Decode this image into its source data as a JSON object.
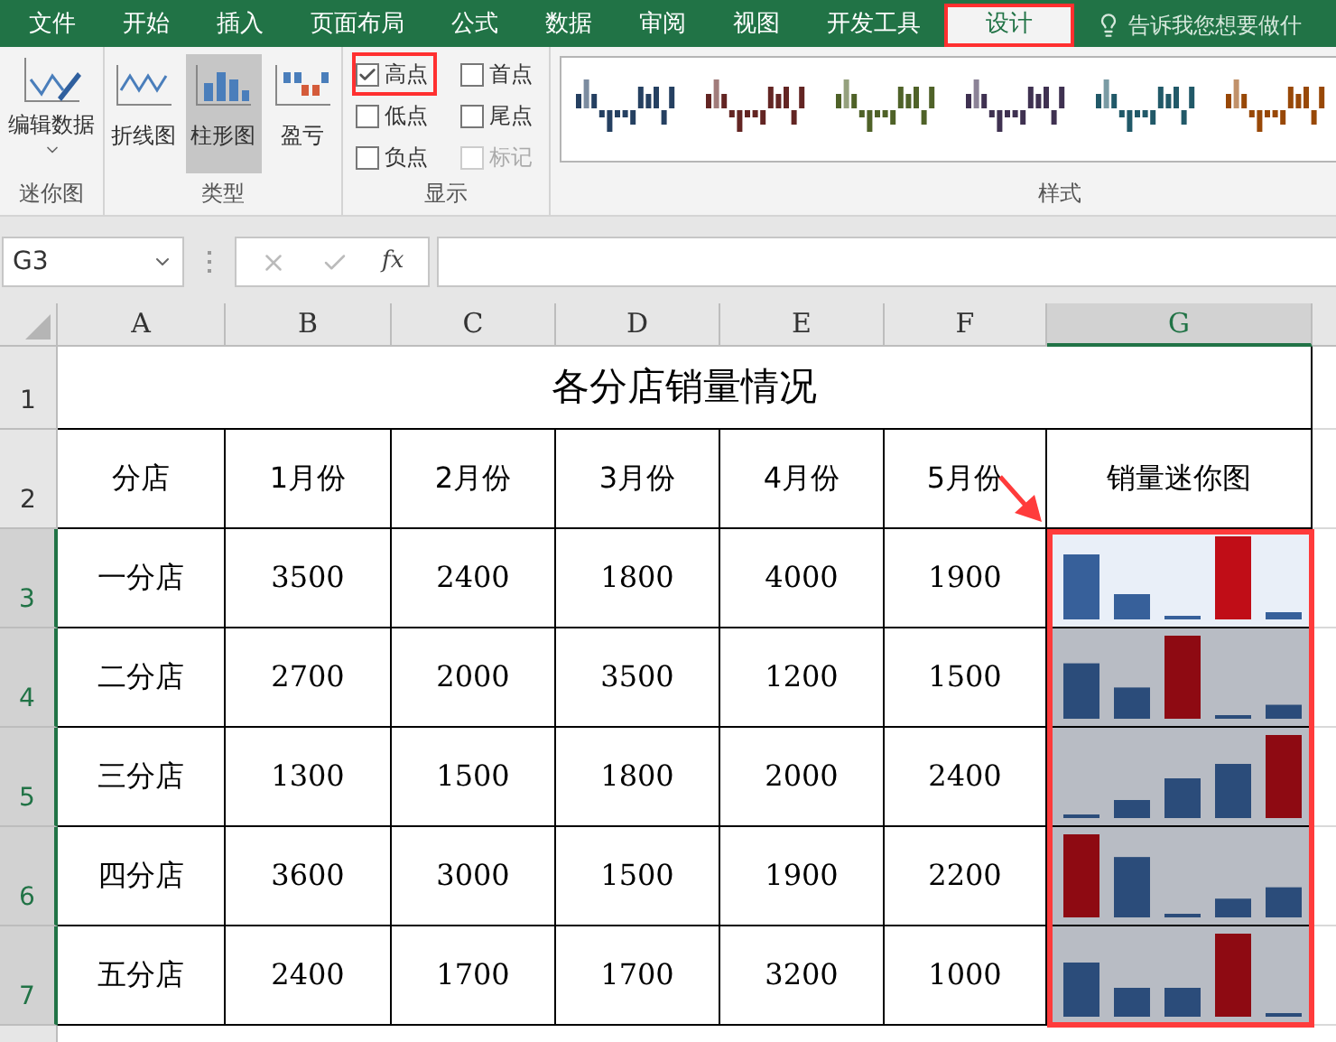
{
  "ribbon_tabs": [
    {
      "label": "文件",
      "selected": false,
      "callout": false
    },
    {
      "label": "开始",
      "selected": false,
      "callout": false
    },
    {
      "label": "插入",
      "selected": false,
      "callout": false
    },
    {
      "label": "页面布局",
      "selected": false,
      "callout": false
    },
    {
      "label": "公式",
      "selected": false,
      "callout": false
    },
    {
      "label": "数据",
      "selected": false,
      "callout": false
    },
    {
      "label": "审阅",
      "selected": false,
      "callout": false
    },
    {
      "label": "视图",
      "selected": false,
      "callout": false
    },
    {
      "label": "开发工具",
      "selected": false,
      "callout": false
    },
    {
      "label": "设计",
      "selected": true,
      "callout": true
    }
  ],
  "tell_me": "告诉我您想要做什",
  "sparkline_group": {
    "label": "迷你图",
    "edit_button": "编辑数据"
  },
  "type_group": {
    "label": "类型",
    "items": [
      {
        "label": "折线图",
        "kind": "line",
        "selected": false
      },
      {
        "label": "柱形图",
        "kind": "column",
        "selected": true
      },
      {
        "label": "盈亏",
        "kind": "winloss",
        "selected": false
      }
    ]
  },
  "show_group": {
    "label": "显示",
    "options": [
      {
        "label": "高点",
        "kind": "high",
        "checked": true,
        "disabled": false,
        "callout": true
      },
      {
        "label": "首点",
        "kind": "first",
        "checked": false,
        "disabled": false,
        "callout": false
      },
      {
        "label": "低点",
        "kind": "low",
        "checked": false,
        "disabled": false,
        "callout": false
      },
      {
        "label": "尾点",
        "kind": "last",
        "checked": false,
        "disabled": false,
        "callout": false
      },
      {
        "label": "负点",
        "kind": "negative",
        "checked": false,
        "disabled": false,
        "callout": false
      },
      {
        "label": "标记",
        "kind": "markers",
        "checked": false,
        "disabled": true,
        "callout": false
      }
    ]
  },
  "style_group": {
    "label": "样式",
    "styles": [
      {
        "color": "#254061"
      },
      {
        "color": "#632523"
      },
      {
        "color": "#4f6228"
      },
      {
        "color": "#3f3151"
      },
      {
        "color": "#215968"
      },
      {
        "color": "#984807"
      }
    ]
  },
  "name_box": "G3",
  "fx_label": "fx",
  "column_headers": [
    {
      "label": "A",
      "selected": false
    },
    {
      "label": "B",
      "selected": false
    },
    {
      "label": "C",
      "selected": false
    },
    {
      "label": "D",
      "selected": false
    },
    {
      "label": "E",
      "selected": false
    },
    {
      "label": "F",
      "selected": false
    },
    {
      "label": "G",
      "selected": true
    }
  ],
  "sheet": {
    "title_row": "1",
    "title": "各分店销量情况",
    "header_row": "2",
    "headers": [
      "分店",
      "1月份",
      "2月份",
      "3月份",
      "4月份",
      "5月份",
      "销量迷你图"
    ],
    "rows": [
      {
        "row": "3",
        "store": "一分店",
        "values": [
          "3500",
          "2400",
          "1800",
          "4000",
          "1900"
        ],
        "selected": true,
        "active": true
      },
      {
        "row": "4",
        "store": "二分店",
        "values": [
          "2700",
          "2000",
          "3500",
          "1200",
          "1500"
        ],
        "selected": true,
        "active": false
      },
      {
        "row": "5",
        "store": "三分店",
        "values": [
          "1300",
          "1500",
          "1800",
          "2000",
          "2400"
        ],
        "selected": true,
        "active": false
      },
      {
        "row": "6",
        "store": "四分店",
        "values": [
          "3600",
          "3000",
          "1500",
          "1900",
          "2200"
        ],
        "selected": true,
        "active": false
      },
      {
        "row": "7",
        "store": "五分店",
        "values": [
          "2400",
          "1700",
          "1700",
          "3200",
          "1000"
        ],
        "selected": true,
        "active": false
      }
    ],
    "range_callout": true
  }
}
